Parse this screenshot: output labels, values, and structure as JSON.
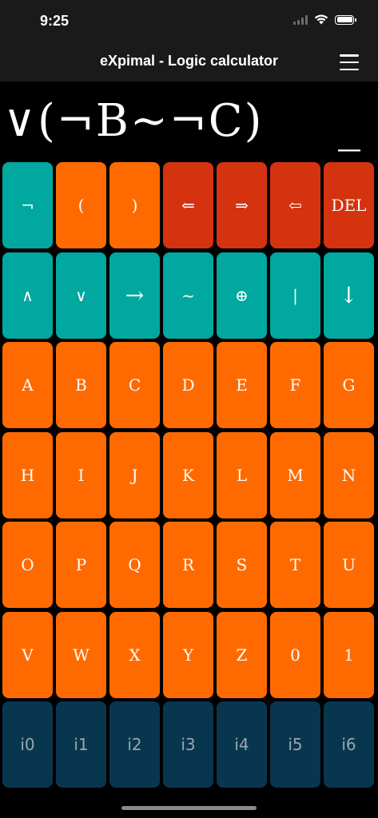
{
  "status": {
    "time": "9:25",
    "wifi_icon": "wifi-icon",
    "battery_level": 1.0
  },
  "nav": {
    "title": "eXpimal - Logic calculator",
    "menu_icon": "hamburger-menu-icon"
  },
  "display": {
    "expression": "∨(¬B~¬C)",
    "cursor": "_"
  },
  "colors": {
    "teal": "#00a89f",
    "orange": "#ff6a00",
    "red": "#d53210",
    "navy": "#09364f"
  },
  "keys": [
    {
      "label": "¬",
      "color": "teal"
    },
    {
      "label": "(",
      "color": "orange"
    },
    {
      "label": ")",
      "color": "orange"
    },
    {
      "label": "⇐",
      "color": "red"
    },
    {
      "label": "⇒",
      "color": "red"
    },
    {
      "label": "⇦",
      "color": "red"
    },
    {
      "label": "DEL",
      "color": "red"
    },
    {
      "label": "∧",
      "color": "teal"
    },
    {
      "label": "∨",
      "color": "teal"
    },
    {
      "label": "→",
      "color": "teal",
      "big": true
    },
    {
      "label": "~",
      "color": "teal"
    },
    {
      "label": "⊕",
      "color": "teal"
    },
    {
      "label": "|",
      "color": "teal"
    },
    {
      "label": "↓",
      "color": "teal",
      "big": true
    },
    {
      "label": "A",
      "color": "orange"
    },
    {
      "label": "B",
      "color": "orange"
    },
    {
      "label": "C",
      "color": "orange"
    },
    {
      "label": "D",
      "color": "orange"
    },
    {
      "label": "E",
      "color": "orange"
    },
    {
      "label": "F",
      "color": "orange"
    },
    {
      "label": "G",
      "color": "orange"
    },
    {
      "label": "H",
      "color": "orange"
    },
    {
      "label": "I",
      "color": "orange"
    },
    {
      "label": "J",
      "color": "orange"
    },
    {
      "label": "K",
      "color": "orange"
    },
    {
      "label": "L",
      "color": "orange"
    },
    {
      "label": "M",
      "color": "orange"
    },
    {
      "label": "N",
      "color": "orange"
    },
    {
      "label": "O",
      "color": "orange"
    },
    {
      "label": "P",
      "color": "orange"
    },
    {
      "label": "Q",
      "color": "orange"
    },
    {
      "label": "R",
      "color": "orange"
    },
    {
      "label": "S",
      "color": "orange"
    },
    {
      "label": "T",
      "color": "orange"
    },
    {
      "label": "U",
      "color": "orange"
    },
    {
      "label": "V",
      "color": "orange"
    },
    {
      "label": "W",
      "color": "orange"
    },
    {
      "label": "X",
      "color": "orange"
    },
    {
      "label": "Y",
      "color": "orange"
    },
    {
      "label": "Z",
      "color": "orange"
    },
    {
      "label": "0",
      "color": "orange"
    },
    {
      "label": "1",
      "color": "orange"
    },
    {
      "label": "i0",
      "color": "navy"
    },
    {
      "label": "i1",
      "color": "navy"
    },
    {
      "label": "i2",
      "color": "navy"
    },
    {
      "label": "i3",
      "color": "navy"
    },
    {
      "label": "i4",
      "color": "navy"
    },
    {
      "label": "i5",
      "color": "navy"
    },
    {
      "label": "i6",
      "color": "navy"
    }
  ]
}
